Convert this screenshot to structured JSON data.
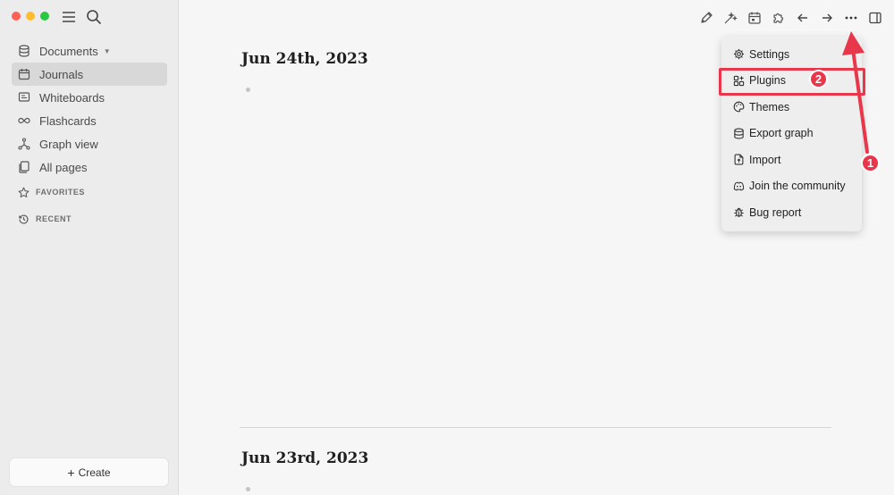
{
  "sidebar": {
    "items": [
      {
        "label": "Documents",
        "icon": "database-icon",
        "dropdown": true
      },
      {
        "label": "Journals",
        "icon": "calendar-icon",
        "active": true
      },
      {
        "label": "Whiteboards",
        "icon": "whiteboard-icon"
      },
      {
        "label": "Flashcards",
        "icon": "infinity-icon"
      },
      {
        "label": "Graph view",
        "icon": "graph-icon"
      },
      {
        "label": "All pages",
        "icon": "pages-icon"
      }
    ],
    "sections": [
      {
        "label": "FAVORITES",
        "icon": "star-icon"
      },
      {
        "label": "RECENT",
        "icon": "history-icon"
      }
    ],
    "create_label": "Create"
  },
  "journals": [
    {
      "title": "Jun 24th, 2023"
    },
    {
      "title": "Jun 23rd, 2023"
    }
  ],
  "menu": {
    "items": [
      {
        "label": "Settings",
        "icon": "gear-icon"
      },
      {
        "label": "Plugins",
        "icon": "plugins-icon"
      },
      {
        "label": "Themes",
        "icon": "palette-icon"
      },
      {
        "label": "Export graph",
        "icon": "database-icon"
      },
      {
        "label": "Import",
        "icon": "file-import-icon"
      },
      {
        "label": "Join the community",
        "icon": "discord-icon"
      },
      {
        "label": "Bug report",
        "icon": "bug-icon"
      }
    ]
  },
  "annotations": {
    "badge1": "1",
    "badge2": "2",
    "color": "#e8364a"
  }
}
